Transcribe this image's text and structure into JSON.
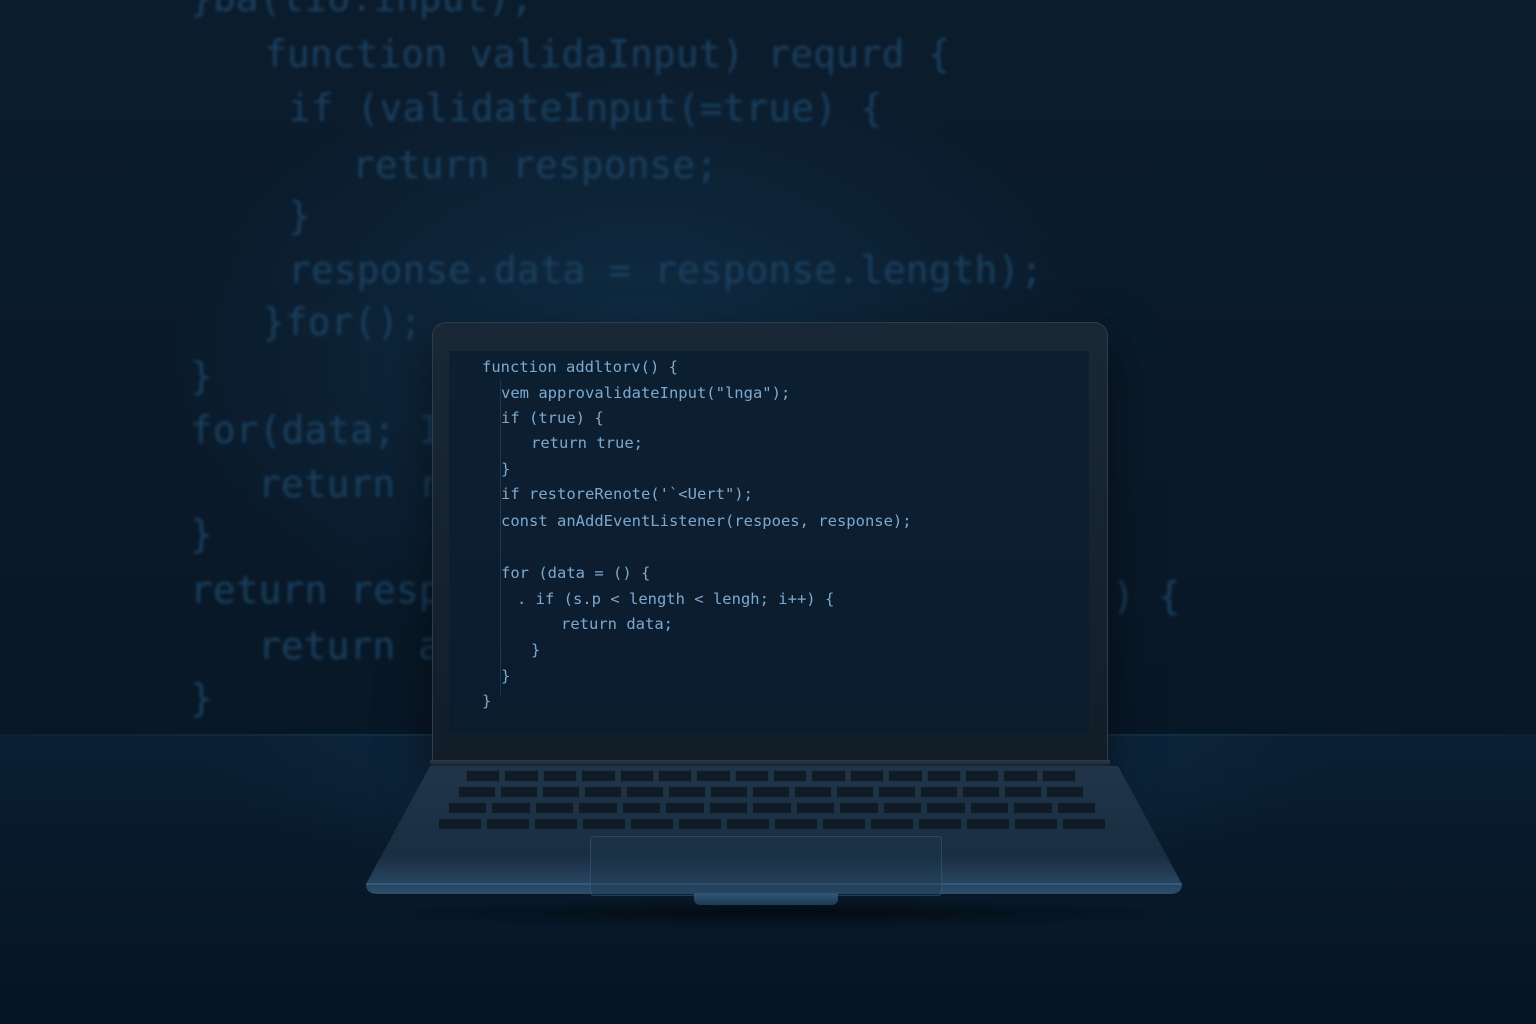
{
  "background_code_lines": [
    "}ba(tio.input);",
    "function validaInput) requrd {",
    "if (validateInput(=true) {",
    "return response;",
    "}",
    "response.data = response.length);",
    "}for();",
    "}",
    "for(data; I",
    "return r",
    "}",
    "return resp",
    ") {",
    "return a",
    "}"
  ],
  "screen_code_lines": [
    "function addltorv() {",
    "vem approvalidateInput(\"lnga\");",
    "if (true) {",
    "return true;",
    "}",
    "if restoreRenote('`<Uert\");",
    "const anAddEventListener(respoes, response);",
    "for (data = () {",
    ". if (s.p < length < lengh; i++) {",
    "return data;",
    "}",
    "}",
    "}"
  ],
  "colors": {
    "background": "#071523",
    "background_code": "#1c4262",
    "screen_code": "#7ea9cf",
    "screen": "#0c1f31"
  }
}
